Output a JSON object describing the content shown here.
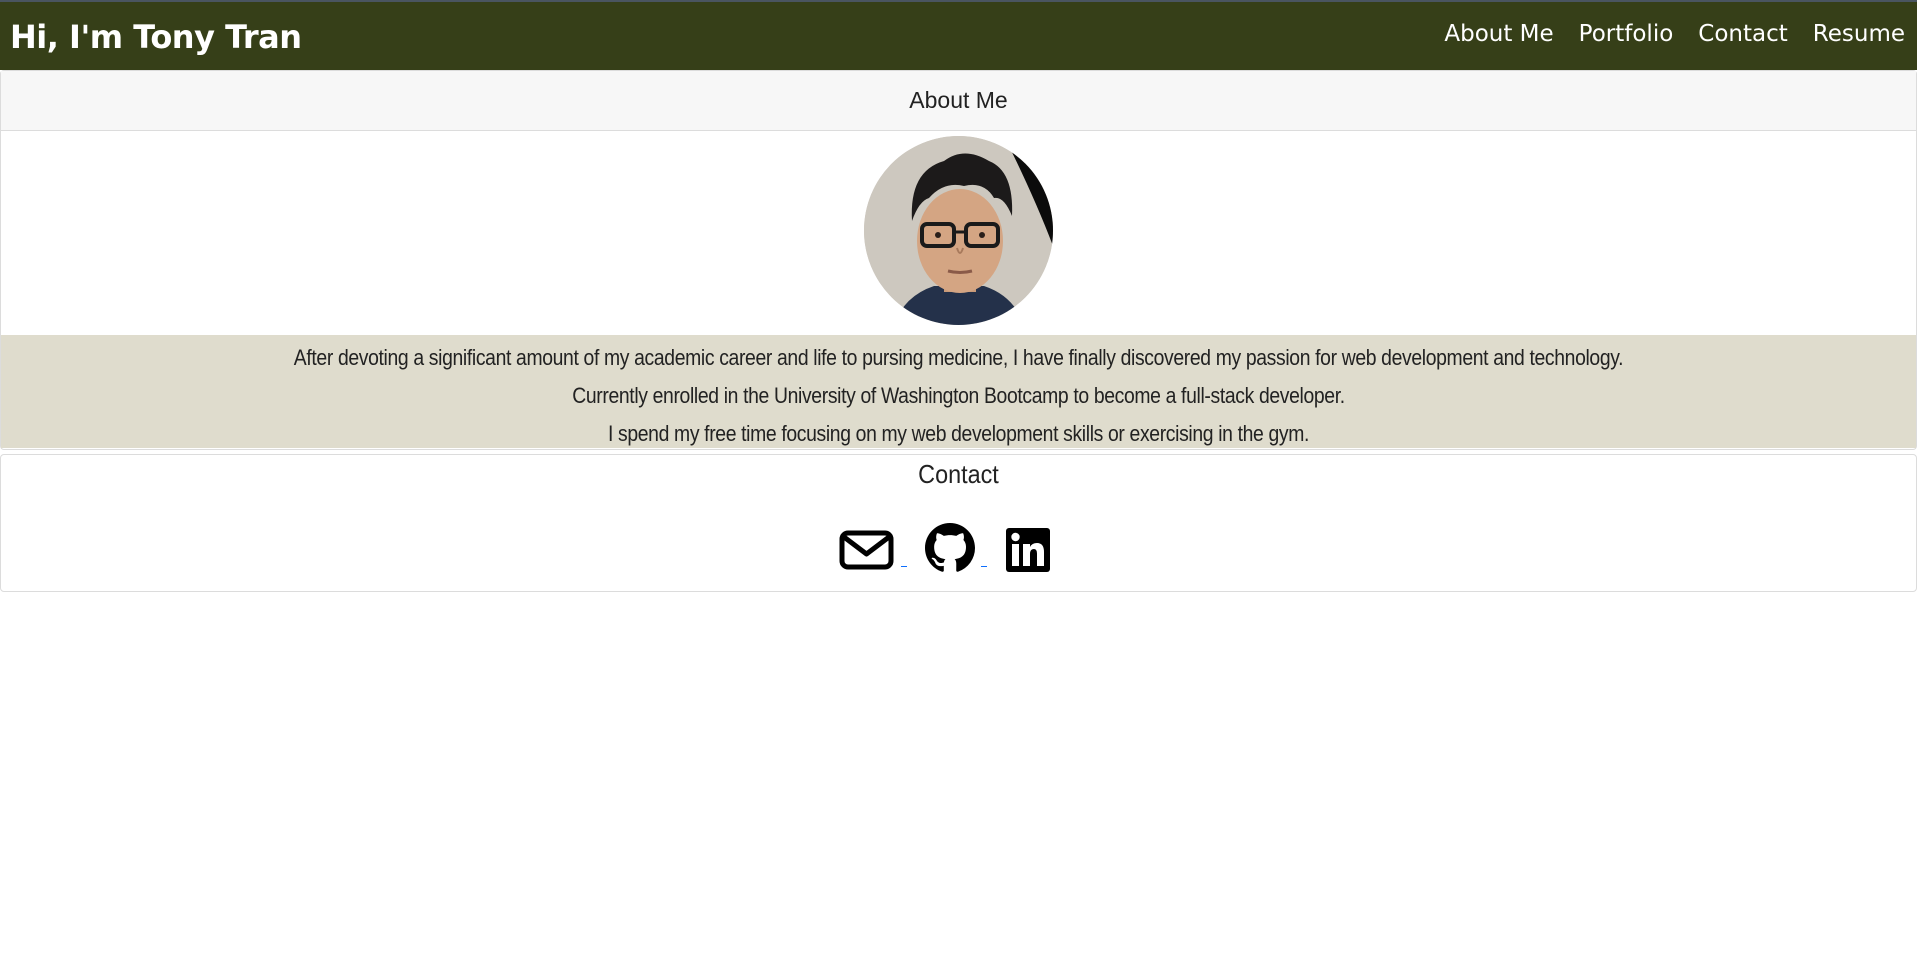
{
  "header": {
    "brand": "Hi, I'm Tony Tran",
    "nav": [
      {
        "label": "About Me"
      },
      {
        "label": "Portfolio"
      },
      {
        "label": "Contact"
      },
      {
        "label": "Resume"
      }
    ]
  },
  "about": {
    "title": "About Me",
    "bio": [
      "After devoting a significant amount of my academic career and life to pursing medicine, I have finally discovered my passion for web development and technology.",
      "Currently enrolled in the University of Washington Bootcamp to become a full-stack developer.",
      "I spend my free time focusing on my web development skills or exercising in the gym."
    ]
  },
  "contact": {
    "title": "Contact",
    "icons": [
      "envelope-icon",
      "github-icon",
      "linkedin-icon"
    ]
  },
  "colors": {
    "navbar": "#363f18",
    "bio_background": "#dfdccd",
    "card_header": "#f7f7f7"
  }
}
